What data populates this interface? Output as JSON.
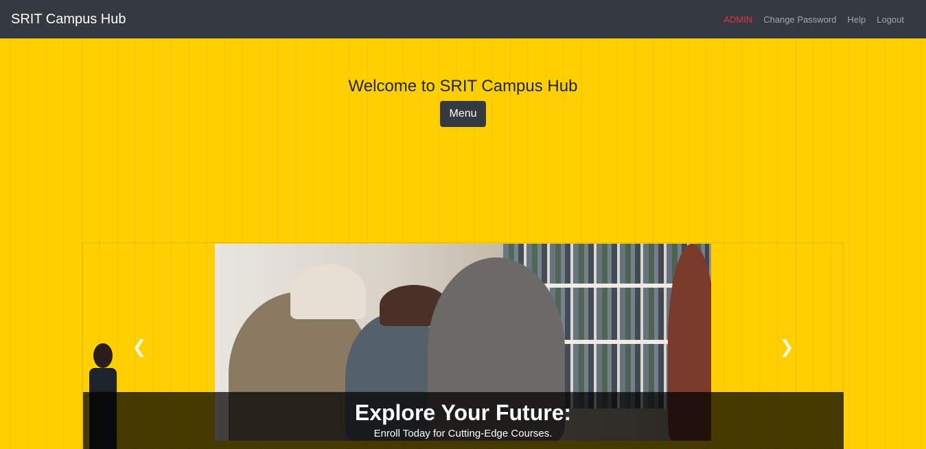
{
  "navbar": {
    "brand": "SRIT Campus Hub",
    "links": [
      "ADMIN",
      "Change Password",
      "Help",
      "Logout"
    ]
  },
  "hero": {
    "welcome": "Welcome to SRIT Campus Hub",
    "menu_label": "Menu"
  },
  "carousel": {
    "title": "Explore Your Future:",
    "subtitle": "Enroll Today for Cutting-Edge Courses.",
    "prev_icon": "chevron-left-icon",
    "next_icon": "chevron-right-icon"
  },
  "colors": {
    "navbar_bg": "#343a40",
    "hero_bg": "#ffd000",
    "admin_link": "#dc3545",
    "button_bg": "#343a40"
  }
}
